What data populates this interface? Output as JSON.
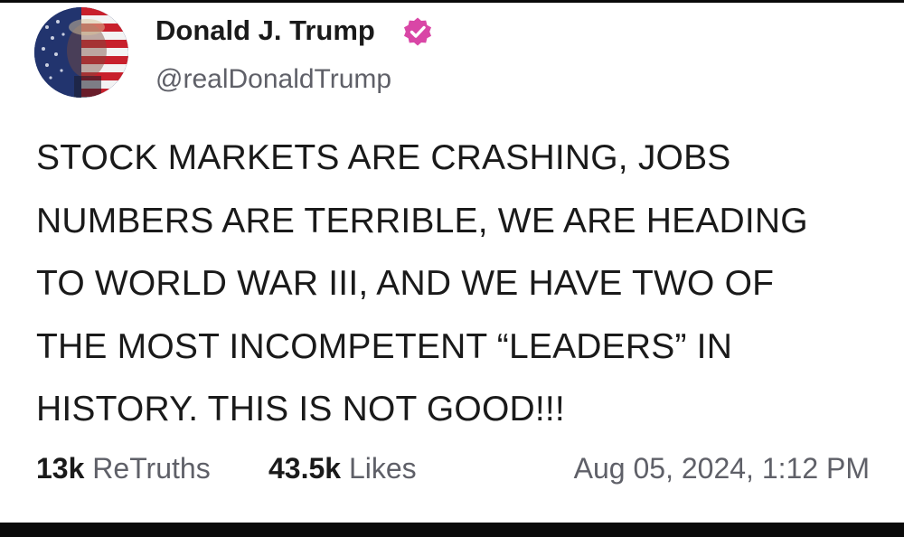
{
  "post": {
    "author": {
      "display_name": "Donald J. Trump",
      "handle": "@realDonaldTrump",
      "verified": true,
      "verified_badge_color": "#d946a6",
      "avatar_icon": "profile-photo-flag-overlay"
    },
    "body_lines": [
      "STOCK MARKETS ARE CRASHING, JOBS",
      "NUMBERS ARE TERRIBLE, WE ARE HEADING",
      "TO WORLD WAR III, AND WE HAVE TWO OF",
      "THE MOST INCOMPETENT “LEADERS” IN",
      "HISTORY. THIS IS NOT GOOD!!!"
    ],
    "stats": {
      "retruths_count": "13k",
      "retruths_label": "ReTruths",
      "likes_count": "43.5k",
      "likes_label": "Likes"
    },
    "timestamp": "Aug 05, 2024, 1:12 PM"
  },
  "colors": {
    "text_primary": "#1a1a1a",
    "text_secondary": "#5f6068",
    "background": "#ffffff"
  }
}
